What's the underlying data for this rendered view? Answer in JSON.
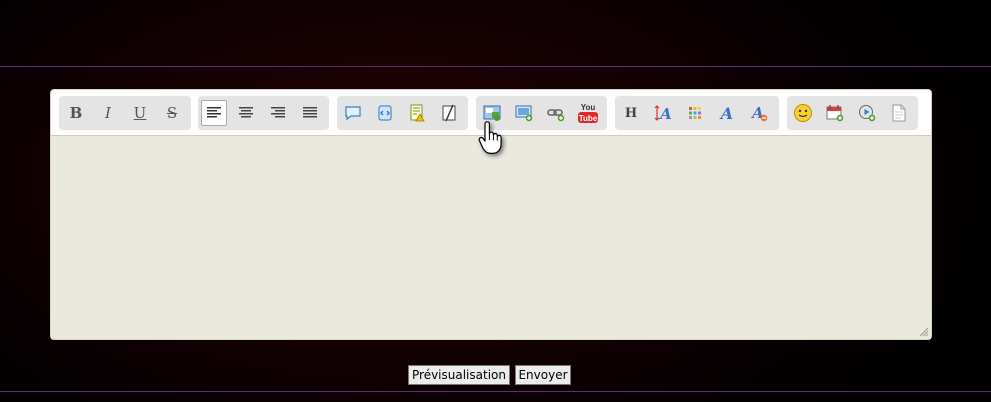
{
  "toolbar": {
    "format": {
      "bold": "B",
      "italic": "I",
      "underline": "U",
      "strike": "S"
    },
    "heading": "H",
    "youtube": {
      "top": "You",
      "bottom": "Tube"
    }
  },
  "actions": {
    "preview": "Prévisualisation",
    "send": "Envoyer"
  }
}
